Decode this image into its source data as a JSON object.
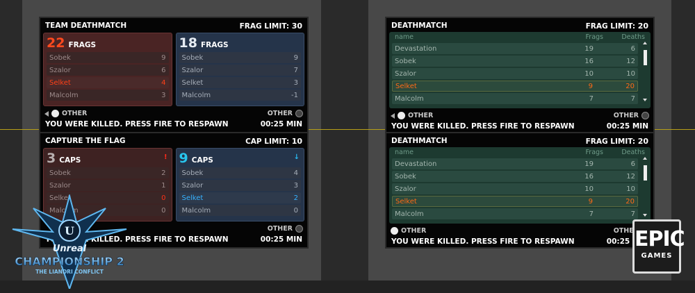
{
  "tdm": {
    "title": "TEAM DEATHMATCH",
    "limit_label": "FRAG LIMIT:",
    "limit_value": "30",
    "red": {
      "score": "22",
      "unit": "FRAGS",
      "players": [
        {
          "name": "Sobek",
          "value": "9"
        },
        {
          "name": "Szalor",
          "value": "6"
        },
        {
          "name": "Selket",
          "value": "4"
        },
        {
          "name": "Malcolm",
          "value": "3"
        }
      ]
    },
    "blue": {
      "score": "18",
      "unit": "FRAGS",
      "players": [
        {
          "name": "Sobek",
          "value": "9"
        },
        {
          "name": "Szalor",
          "value": "7"
        },
        {
          "name": "Selket",
          "value": "3"
        },
        {
          "name": "Malcolm",
          "value": "-1"
        }
      ]
    },
    "other_left": "OTHER",
    "other_right": "OTHER",
    "message": "YOU WERE KILLED. PRESS FIRE TO RESPAWN",
    "time": "00:25 MIN"
  },
  "ctf": {
    "title": "CAPTURE THE FLAG",
    "limit_label": "CAP LIMIT:",
    "limit_value": "10",
    "red": {
      "score": "3",
      "unit": "CAPS",
      "flag": "!",
      "players": [
        {
          "name": "Sobek",
          "value": "2"
        },
        {
          "name": "Szalor",
          "value": "1"
        },
        {
          "name": "Selket",
          "value": "0"
        },
        {
          "name": "Malcolm",
          "value": "0"
        }
      ]
    },
    "blue": {
      "score": "9",
      "unit": "CAPS",
      "flag": "↓",
      "players": [
        {
          "name": "Sobek",
          "value": "4"
        },
        {
          "name": "Szalor",
          "value": "3"
        },
        {
          "name": "Selket",
          "value": "2"
        },
        {
          "name": "Malcolm",
          "value": "0"
        }
      ]
    },
    "other_right": "OTHER",
    "message": "YOU WERE KILLED. PRESS FIRE TO RESPAWN",
    "time": "00:25 MIN"
  },
  "dm1": {
    "title": "DEATHMATCH",
    "limit_label": "FRAG LIMIT:",
    "limit_value": "20",
    "col_name": "name",
    "col_frags": "Frags",
    "col_deaths": "Deaths",
    "rows": [
      {
        "name": "Devastation",
        "frags": "19",
        "deaths": "6"
      },
      {
        "name": "Sobek",
        "frags": "16",
        "deaths": "12"
      },
      {
        "name": "Szalor",
        "frags": "10",
        "deaths": "10"
      },
      {
        "name": "Selket",
        "frags": "9",
        "deaths": "20"
      },
      {
        "name": "Malcolm",
        "frags": "7",
        "deaths": "7"
      }
    ],
    "other_left": "OTHER",
    "other_right": "OTHER",
    "message": "YOU WERE KILLED. PRESS FIRE TO RESPAWN",
    "time": "00:25 MIN"
  },
  "dm2": {
    "title": "DEATHMATCH",
    "limit_label": "FRAG LIMIT:",
    "limit_value": "20",
    "col_name": "name",
    "col_frags": "Frags",
    "col_deaths": "Deaths",
    "rows": [
      {
        "name": "Devastation",
        "frags": "19",
        "deaths": "6"
      },
      {
        "name": "Sobek",
        "frags": "16",
        "deaths": "12"
      },
      {
        "name": "Szalor",
        "frags": "10",
        "deaths": "10"
      },
      {
        "name": "Selket",
        "frags": "9",
        "deaths": "20"
      },
      {
        "name": "Malcolm",
        "frags": "7",
        "deaths": "7"
      }
    ],
    "other_left": "OTHER",
    "other_right": "OTHER",
    "message": "YOU WERE KILLED. PRESS FIRE TO RESPAWN",
    "time": "00:25 MIN"
  },
  "logos": {
    "ut_word": "Unreal",
    "ut_title": "CHAMPIONSHIP 2",
    "ut_sub": "THE LIANDRI CONFLICT",
    "epic_big": "EPIC",
    "epic_small": "GAMES"
  },
  "colors": {
    "red_highlight": "#ff4018",
    "blue_highlight": "#36b2ff",
    "dm_highlight": "#ff6a16"
  }
}
